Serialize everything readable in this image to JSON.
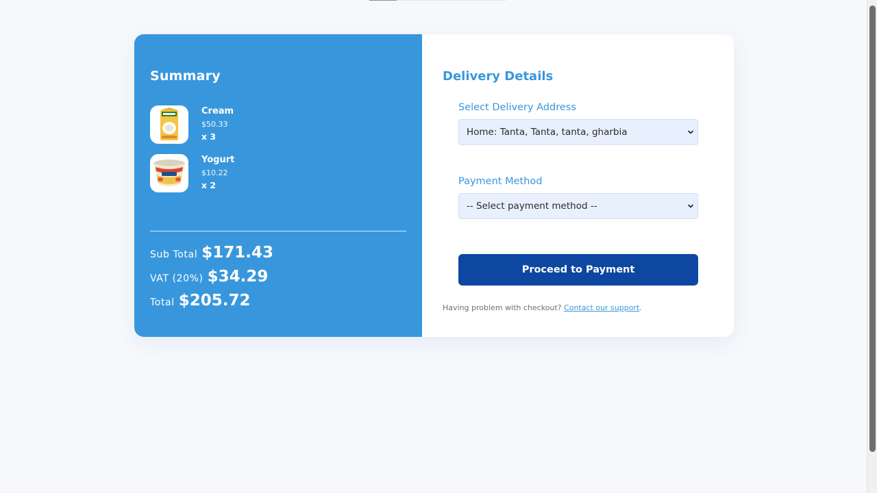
{
  "summary": {
    "title": "Summary",
    "items": [
      {
        "name": "Cream",
        "price": "$50.33",
        "qty": "x 3",
        "icon": "cream-carton-image"
      },
      {
        "name": "Yogurt",
        "price": "$10.22",
        "qty": "x 2",
        "icon": "yogurt-cup-image"
      }
    ],
    "totals": [
      {
        "label": "Sub Total",
        "value": "$171.43"
      },
      {
        "label": "VAT (20%)",
        "value": "$34.29"
      },
      {
        "label": "Total",
        "value": "$205.72"
      }
    ]
  },
  "details": {
    "title": "Delivery Details",
    "address_label": "Select Delivery Address",
    "address_value": "Home: Tanta, Tanta, tanta, gharbia",
    "payment_label": "Payment Method",
    "payment_value": "-- Select payment method --",
    "proceed_label": "Proceed to Payment",
    "help_text": "Having problem with checkout?",
    "help_link": "Contact our support",
    "help_suffix": "."
  },
  "colors": {
    "summary_bg": "#3897dc",
    "accent": "#3897dc",
    "button_bg": "#0d47a1",
    "select_bg": "#e8f0fd"
  }
}
